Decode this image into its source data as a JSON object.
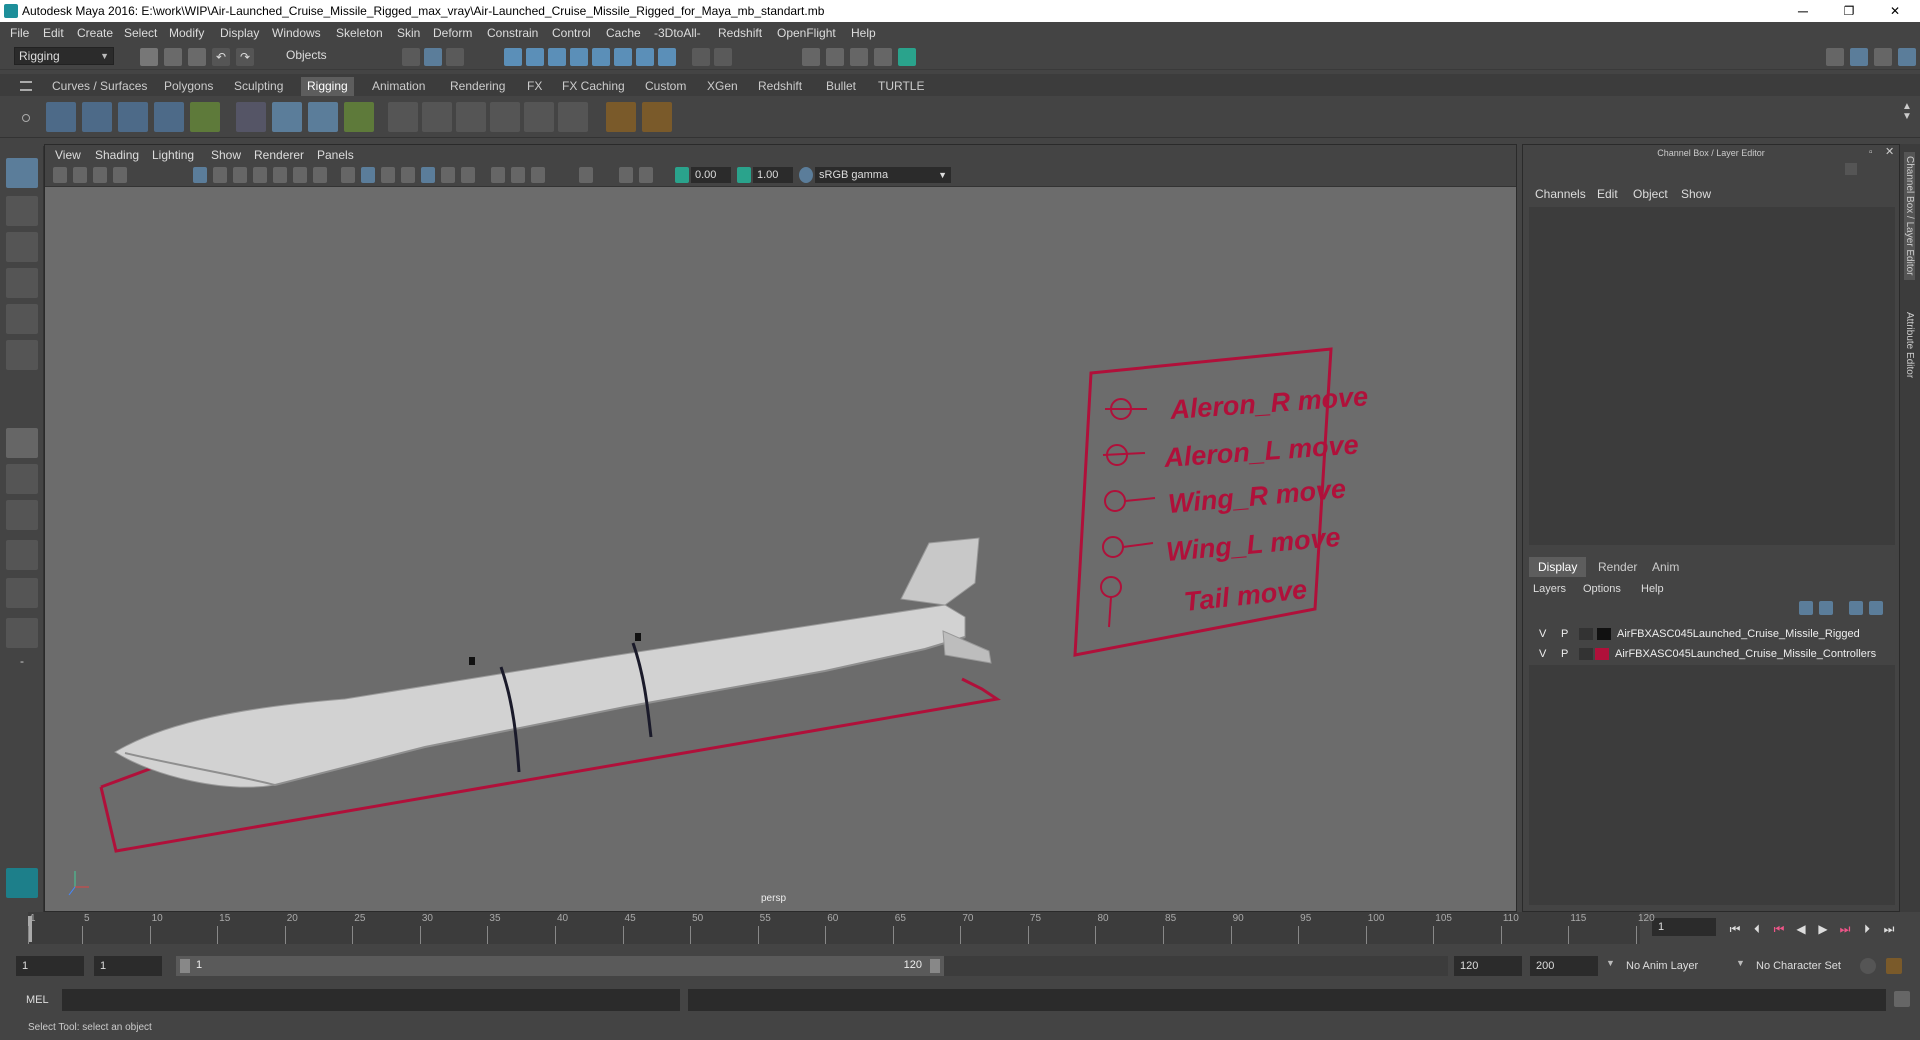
{
  "window": {
    "title": "Autodesk Maya 2016: E:\\work\\WIP\\Air-Launched_Cruise_Missile_Rigged_max_vray\\Air-Launched_Cruise_Missile_Rigged_for_Maya_mb_standart.mb",
    "minimize": "─",
    "restore": "❐",
    "close": "✕"
  },
  "menubar": [
    "File",
    "Edit",
    "Create",
    "Select",
    "Modify",
    "Display",
    "Windows",
    "Skeleton",
    "Skin",
    "Deform",
    "Constrain",
    "Control",
    "Cache",
    "-3DtoAll-",
    "Redshift",
    "OpenFlight",
    "Help"
  ],
  "statusline": {
    "mode": "Rigging",
    "select_mode": "Objects"
  },
  "shelf_tabs": [
    "Curves / Surfaces",
    "Polygons",
    "Sculpting",
    "Rigging",
    "Animation",
    "Rendering",
    "FX",
    "FX Caching",
    "Custom",
    "XGen",
    "Redshift",
    "Bullet",
    "TURTLE"
  ],
  "active_shelf_tab": "Rigging",
  "viewport": {
    "menu": [
      "View",
      "Shading",
      "Lighting",
      "Show",
      "Renderer",
      "Panels"
    ],
    "exposure": "0.00",
    "gamma": "1.00",
    "color_space": "sRGB gamma",
    "camera_label": "persp",
    "controls_board": [
      "Aleron_R move",
      "Aleron_L move",
      "Wing_R move",
      "Wing_L move",
      "Tail move"
    ],
    "colors": {
      "curve": "#b0103a",
      "missile": "#cfcfcf",
      "background": "#6c6c6c"
    }
  },
  "channel_box": {
    "title": "Channel Box / Layer Editor",
    "menu": [
      "Channels",
      "Edit",
      "Object",
      "Show"
    ],
    "layer_tabs": [
      "Display",
      "Render",
      "Anim"
    ],
    "active_layer_tab": "Display",
    "layer_menu": [
      "Layers",
      "Options",
      "Help"
    ],
    "layers": [
      {
        "v": "V",
        "p": "P",
        "color": "#111111",
        "name": "AirFBXASC045Launched_Cruise_Missile_Rigged"
      },
      {
        "v": "V",
        "p": "P",
        "color": "#b0103a",
        "name": "AirFBXASC045Launched_Cruise_Missile_Controllers"
      }
    ]
  },
  "side_tabs": [
    "Channel Box / Layer Editor",
    "Attribute Editor"
  ],
  "timeline": {
    "ticks": [
      "1",
      "5",
      "10",
      "15",
      "20",
      "25",
      "30",
      "35",
      "40",
      "45",
      "50",
      "55",
      "60",
      "65",
      "70",
      "75",
      "80",
      "85",
      "90",
      "95",
      "100",
      "105",
      "110",
      "115",
      "120"
    ],
    "current_frame": "1"
  },
  "range": {
    "start": "1",
    "playback_start": "1",
    "slider_start": "1",
    "slider_end": "120",
    "playback_end": "120",
    "end": "200",
    "anim_layer": "No Anim Layer",
    "character_set": "No Character Set"
  },
  "command_line": {
    "label": "MEL"
  },
  "help_line": "Select Tool: select an object"
}
